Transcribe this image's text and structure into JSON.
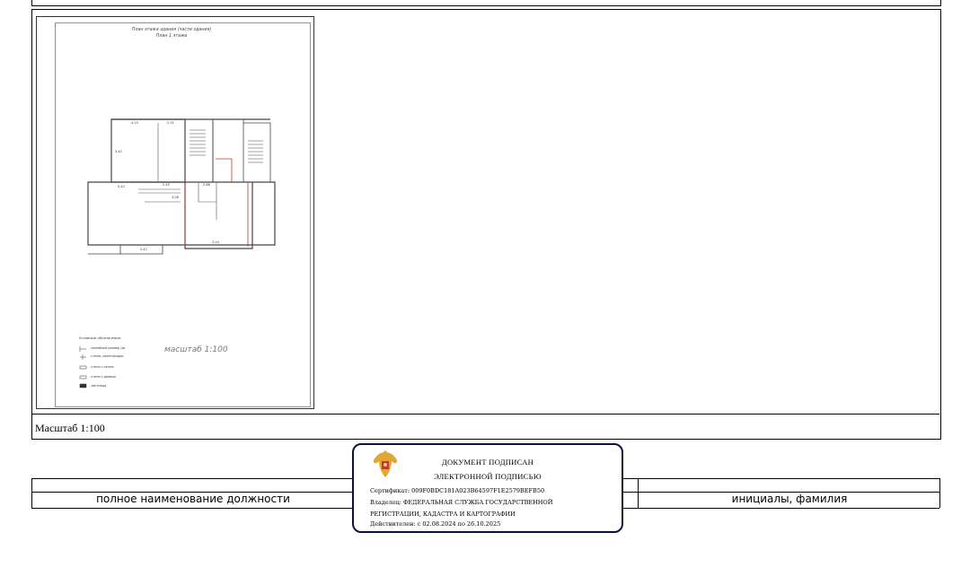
{
  "plan": {
    "title_line1": "План этажа здания (части здания)",
    "title_line2": "План 1 этажа",
    "scale_label": "масштаб 1:100",
    "legend_title": "Условные обозначения",
    "legend_items": [
      "- линейный размер (м)",
      "- стены, перегородки",
      "- стена с окном",
      "- стена с дверью",
      "- лестница"
    ],
    "room_labels": [
      "4.10",
      "2.31",
      "5.42",
      "2.45",
      "3.08",
      "5.47",
      "5.42",
      "2.88",
      "3.24"
    ]
  },
  "scale_caption": "Масштаб 1:100",
  "signature": {
    "position_caption": "полное наименование должности",
    "name_caption": "инициалы, фамилия"
  },
  "stamp": {
    "title_line1": "ДОКУМЕНТ ПОДПИСАН",
    "title_line2": "ЭЛЕКТРОННОЙ ПОДПИСЬЮ",
    "certificate": "Сертификат: 009F0BDC181A023B64597F1E2579BEFB50",
    "owner": "Владелец: ФЕДЕРАЛЬНАЯ СЛУЖБА ГОСУДАРСТВЕННОЙ",
    "owner_cont": "РЕГИСТРАЦИИ, КАДАСТРА И КАРТОГРАФИИ",
    "valid": "Действителен: с 02.08.2024 по 26.10.2025",
    "emblem": "coat-of-arms-icon"
  }
}
